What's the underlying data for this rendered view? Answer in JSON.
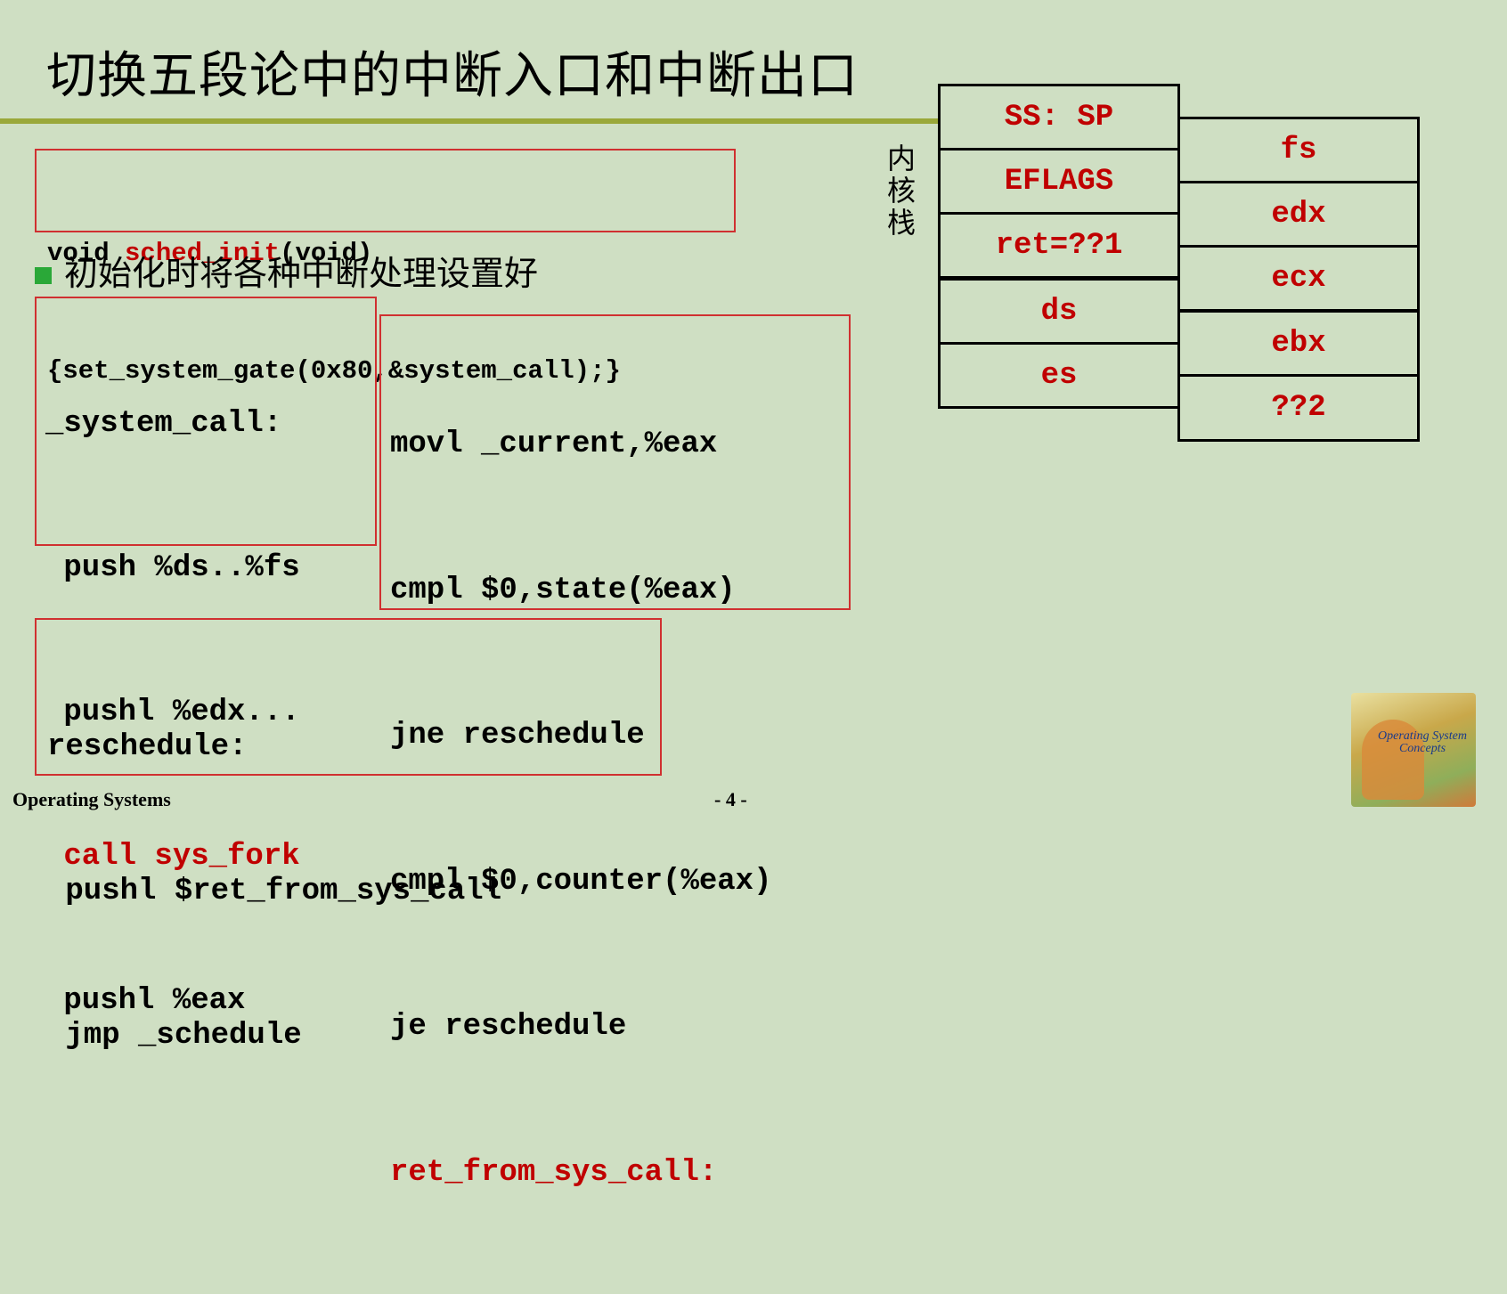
{
  "title": "切换五段论中的中断入口和中断出口",
  "init_box": {
    "line1_pre": "void ",
    "line1_fn": "sched_init",
    "line1_post": "(void)",
    "line2": "{set_system_gate(0x80,&system_call);}"
  },
  "bullet": "初始化时将各种中断处理设置好",
  "syscall_box": {
    "lines": [
      "_system_call:",
      " push %ds..%fs",
      " pushl %edx...",
      " call sys_fork",
      " pushl %eax"
    ]
  },
  "mid_box": {
    "lines": [
      "movl _current,%eax",
      "cmpl $0,state(%eax)",
      "jne reschedule",
      "cmpl $0,counter(%eax)",
      "je reschedule",
      "ret_from_sys_call:"
    ]
  },
  "resched_box": {
    "lines": [
      "reschedule:",
      " pushl $ret_from_sys_call",
      " jmp _schedule"
    ]
  },
  "stack_label": "内核栈",
  "stack_left": [
    "SS: SP",
    "EFLAGS",
    "ret=??1",
    "ds",
    "es"
  ],
  "stack_right": [
    "fs",
    "edx",
    "ecx",
    "ebx",
    "??2"
  ],
  "footer": {
    "left": "Operating Systems",
    "page": "- 4 -"
  },
  "book_cover": {
    "text": "Operating System Concepts"
  },
  "colors": {
    "background": "#cfdfc3",
    "accent_red": "#c00000",
    "rule": "#9aa83a",
    "bullet": "#2aa838"
  }
}
